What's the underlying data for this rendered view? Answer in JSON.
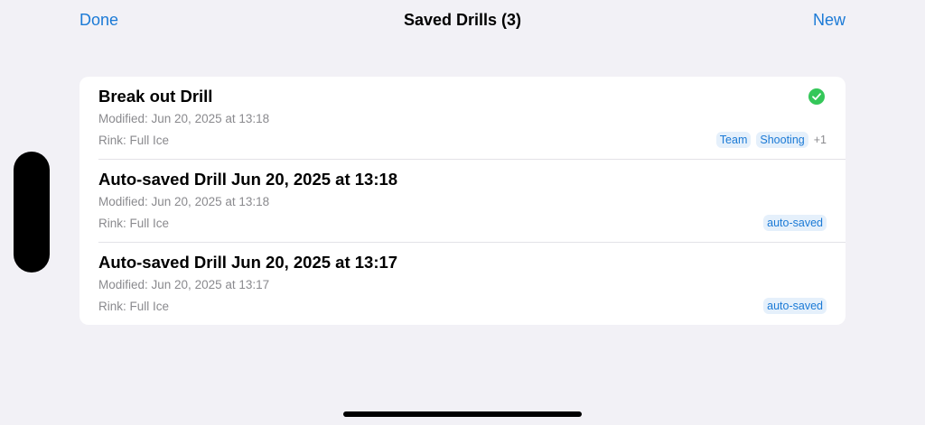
{
  "nav": {
    "done_label": "Done",
    "title": "Saved Drills (3)",
    "new_label": "New"
  },
  "drills": [
    {
      "title": "Break out Drill",
      "modified": "Modified: Jun 20, 2025 at 13:18",
      "rink": "Rink: Full Ice",
      "selected": true,
      "tags": [
        "Team",
        "Shooting"
      ],
      "more_tags": "+1"
    },
    {
      "title": "Auto-saved Drill Jun 20, 2025 at 13:18",
      "modified": "Modified: Jun 20, 2025 at 13:18",
      "rink": "Rink: Full Ice",
      "selected": false,
      "tags": [
        "auto-saved"
      ]
    },
    {
      "title": "Auto-saved Drill Jun 20, 2025 at 13:17",
      "modified": "Modified: Jun 20, 2025 at 13:17",
      "rink": "Rink: Full Ice",
      "selected": false,
      "tags": [
        "auto-saved"
      ]
    }
  ],
  "icons": {
    "selected_indicator": "checkmark-circle-icon"
  },
  "colors": {
    "accent": "#1b7ad6",
    "check": "#34c759",
    "tag_background": "#e5f0fb",
    "secondary_text": "#8a8a8e",
    "background": "#f2f1f6"
  }
}
